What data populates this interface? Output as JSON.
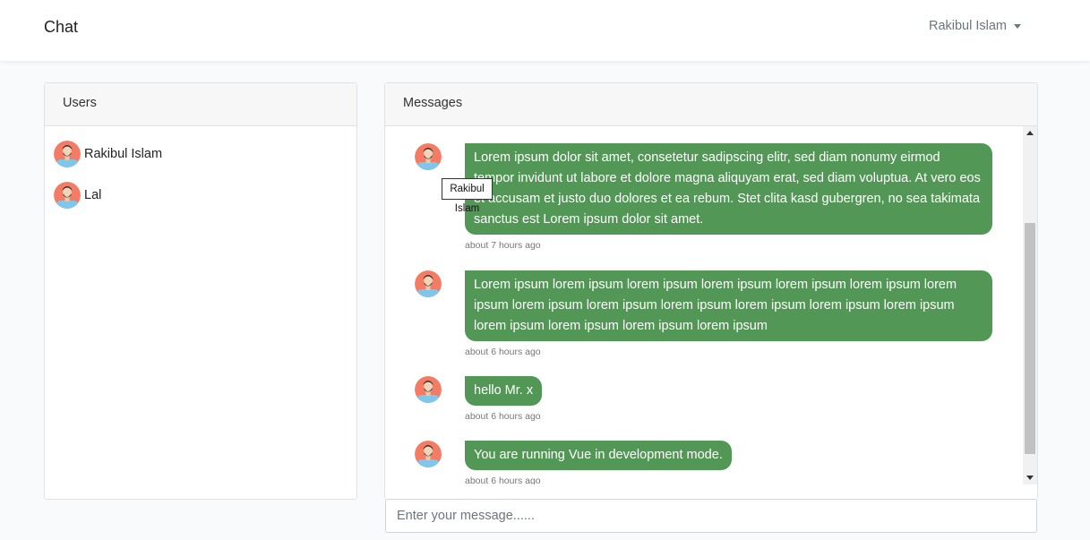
{
  "navbar": {
    "brand": "Chat",
    "user_name": "Rakibul Islam"
  },
  "users_panel": {
    "title": "Users",
    "users": [
      {
        "name": "Rakibul Islam"
      },
      {
        "name": "Lal"
      }
    ]
  },
  "messages_panel": {
    "title": "Messages",
    "messages": [
      {
        "text": "Lorem ipsum dolor sit amet, consetetur sadipscing elitr, sed diam nonumy eirmod tempor invidunt ut labore et dolore magna aliquyam erat, sed diam voluptua. At vero eos et accusam et justo duo dolores et ea rebum. Stet clita kasd gubergren, no sea takimata sanctus est Lorem ipsum dolor sit amet.",
        "time": "about 7 hours ago"
      },
      {
        "text": "Lorem ipsum lorem ipsum lorem ipsum lorem ipsum lorem ipsum lorem ipsum lorem ipsum lorem ipsum lorem ipsum lorem ipsum lorem ipsum lorem ipsum lorem ipsum lorem ipsum lorem ipsum lorem ipsum lorem ipsum",
        "time": "about 6 hours ago"
      },
      {
        "text": "hello Mr. x",
        "time": "about 6 hours ago"
      },
      {
        "text": "You are running Vue in development mode.",
        "time": "about 6 hours ago"
      }
    ]
  },
  "tooltip": {
    "text": "Rakibul Islam"
  },
  "message_input": {
    "placeholder": "Enter your message......"
  },
  "colors": {
    "bubble": "#529756",
    "avatar_bg": "#f47c64",
    "avatar_shirt": "#7fc6ea"
  }
}
